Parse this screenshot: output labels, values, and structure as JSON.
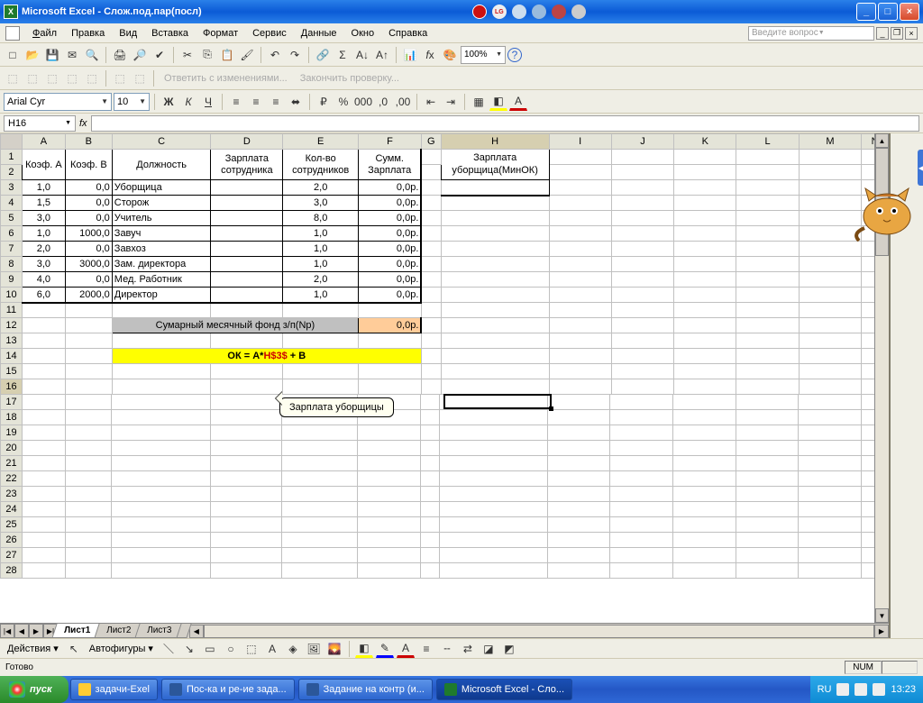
{
  "title": "Microsoft Excel - Слож.под.пар(посл)",
  "menu": [
    "Файл",
    "Правка",
    "Вид",
    "Вставка",
    "Формат",
    "Сервис",
    "Данные",
    "Окно",
    "Справка"
  ],
  "ask_placeholder": "Введите вопрос",
  "review_toolbar": {
    "reply": "Ответить с изменениями...",
    "finish": "Закончить проверку..."
  },
  "font": {
    "name": "Arial Cyr",
    "size": "10"
  },
  "zoom": "100%",
  "namebox": "H16",
  "columns": [
    "A",
    "B",
    "C",
    "D",
    "E",
    "F",
    "G",
    "H",
    "I",
    "J",
    "K",
    "L",
    "M",
    "N"
  ],
  "headers": {
    "A": "Коэф. А",
    "B": "Коэф. В",
    "C": "Должность",
    "D": "Зарплата сотрудника",
    "E": "Кол-во сотрудников",
    "F": "Сумм. Зарплата"
  },
  "h_block": {
    "line1": "Зарплата",
    "line2": "уборщица(МинОК)"
  },
  "rows": [
    {
      "n": 3,
      "A": "1,0",
      "B": "0,0",
      "C": "Уборщица",
      "D": "",
      "E": "2,0",
      "F": "0,0р."
    },
    {
      "n": 4,
      "A": "1,5",
      "B": "0,0",
      "C": "Сторож",
      "D": "",
      "E": "3,0",
      "F": "0,0р."
    },
    {
      "n": 5,
      "A": "3,0",
      "B": "0,0",
      "C": "Учитель",
      "D": "",
      "E": "8,0",
      "F": "0,0р."
    },
    {
      "n": 6,
      "A": "1,0",
      "B": "1000,0",
      "C": "Завуч",
      "D": "",
      "E": "1,0",
      "F": "0,0р."
    },
    {
      "n": 7,
      "A": "2,0",
      "B": "0,0",
      "C": "Завхоз",
      "D": "",
      "E": "1,0",
      "F": "0,0р."
    },
    {
      "n": 8,
      "A": "3,0",
      "B": "3000,0",
      "C": "Зам. директора",
      "D": "",
      "E": "1,0",
      "F": "0,0р."
    },
    {
      "n": 9,
      "A": "4,0",
      "B": "0,0",
      "C": "Мед. Работник",
      "D": "",
      "E": "2,0",
      "F": "0,0р."
    },
    {
      "n": 10,
      "A": "6,0",
      "B": "2000,0",
      "C": "Директор",
      "D": "",
      "E": "1,0",
      "F": "0,0р."
    }
  ],
  "row12_label": "Сумарный месячный фонд з/п(Nр)",
  "row12_val": "0,0р.",
  "formula_prefix": "ОК = А*",
  "formula_red": "Н$3$",
  "formula_suffix": " + В",
  "callout": "Зарплата уборщицы",
  "sheets": [
    "Лист1",
    "Лист2",
    "Лист3"
  ],
  "drawbar": {
    "actions": "Действия",
    "autoshapes": "Автофигуры"
  },
  "status": {
    "ready": "Готово",
    "num": "NUM"
  },
  "taskbar": {
    "start": "пуск",
    "items": [
      "задачи-Exel",
      "Пос-ка и ре-ие зада...",
      "Задание на контр (и...",
      "Microsoft Excel - Сло..."
    ],
    "lang": "RU",
    "time": "13:23"
  }
}
